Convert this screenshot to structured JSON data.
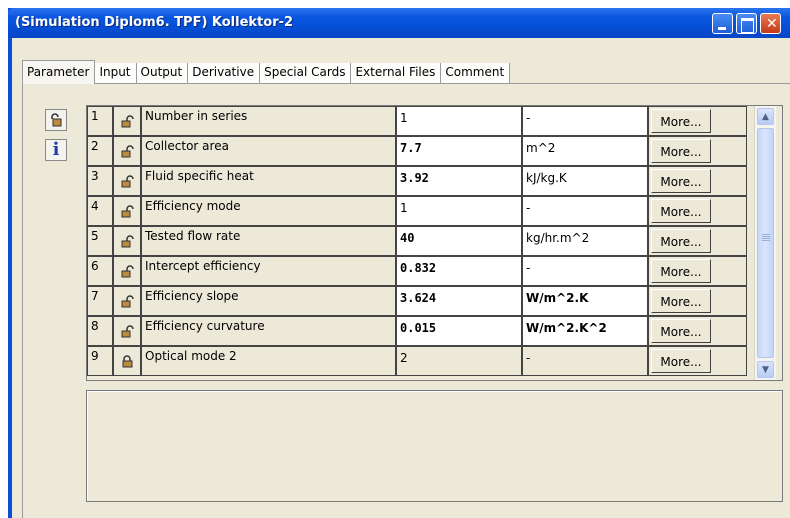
{
  "window": {
    "title": "(Simulation Diplom6. TPF) Kollektor-2",
    "accent_color": "#0a4fd4"
  },
  "tabs": [
    {
      "label": "Parameter",
      "active": true
    },
    {
      "label": "Input",
      "active": false
    },
    {
      "label": "Output",
      "active": false
    },
    {
      "label": "Derivative",
      "active": false
    },
    {
      "label": "Special Cards",
      "active": false
    },
    {
      "label": "External Files",
      "active": false
    },
    {
      "label": "Comment",
      "active": false
    }
  ],
  "side_tools": [
    {
      "icon": "lock-icon"
    },
    {
      "icon": "info-icon",
      "glyph": "i"
    }
  ],
  "parameters": {
    "more_label": "More...",
    "rows": [
      {
        "num": "1",
        "name": "Number in series",
        "value": "1",
        "unit": "-",
        "locked": false,
        "emphasis": false
      },
      {
        "num": "2",
        "name": "Collector area",
        "value": "7.7",
        "unit": "m^2",
        "locked": false,
        "emphasis": true
      },
      {
        "num": "3",
        "name": "Fluid specific heat",
        "value": "3.92",
        "unit": "kJ/kg.K",
        "locked": false,
        "emphasis": true
      },
      {
        "num": "4",
        "name": "Efficiency mode",
        "value": "1",
        "unit": "-",
        "locked": false,
        "emphasis": false
      },
      {
        "num": "5",
        "name": "Tested flow rate",
        "value": "40",
        "unit": "kg/hr.m^2",
        "locked": false,
        "emphasis": true
      },
      {
        "num": "6",
        "name": "Intercept efficiency",
        "value": "0.832",
        "unit": "-",
        "locked": false,
        "emphasis": true
      },
      {
        "num": "7",
        "name": "Efficiency slope",
        "value": "3.624",
        "unit": "W/m^2.K",
        "locked": false,
        "emphasis": true,
        "unit_bold": true
      },
      {
        "num": "8",
        "name": "Efficiency curvature",
        "value": "0.015",
        "unit": "W/m^2.K^2",
        "locked": false,
        "emphasis": true,
        "unit_bold": true
      },
      {
        "num": "9",
        "name": "Optical mode 2",
        "value": "2",
        "unit": "-",
        "locked": true,
        "emphasis": false
      }
    ]
  }
}
